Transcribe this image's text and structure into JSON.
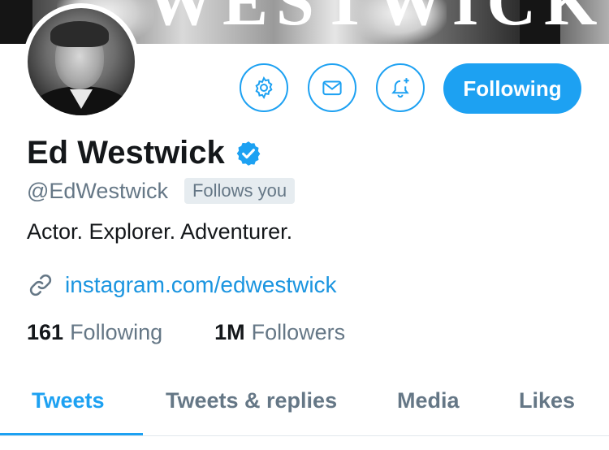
{
  "banner": {
    "text": "WESTWICK"
  },
  "actions": {
    "following_label": "Following"
  },
  "profile": {
    "name": "Ed Westwick",
    "handle": "@EdWestwick",
    "follows_you": "Follows you",
    "bio": "Actor. Explorer. Adventurer.",
    "website": "instagram.com/edwestwick"
  },
  "stats": {
    "following_count": "161",
    "following_label": "Following",
    "followers_count": "1M",
    "followers_label": "Followers"
  },
  "tabs": [
    {
      "label": "Tweets",
      "active": true
    },
    {
      "label": "Tweets & replies",
      "active": false
    },
    {
      "label": "Media",
      "active": false
    },
    {
      "label": "Likes",
      "active": false
    }
  ],
  "colors": {
    "accent": "#1da1f2",
    "link": "#1b95e0",
    "secondary_text": "#657786",
    "primary_text": "#14171a"
  },
  "icons": [
    "gear-icon",
    "envelope-icon",
    "bell-plus-icon",
    "verified-badge-icon",
    "link-icon"
  ]
}
